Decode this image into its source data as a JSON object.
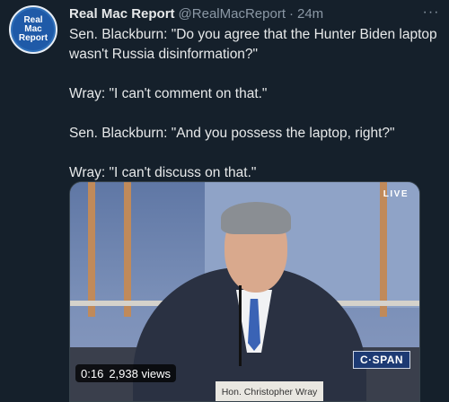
{
  "tweet": {
    "author_name": "Real Mac Report",
    "author_handle": "@RealMacReport",
    "separator": "·",
    "time": "24m",
    "more_label": "···",
    "avatar_lines": [
      "Real",
      "Mac",
      "Report"
    ],
    "text_lines": [
      "Sen. Blackburn: \"Do you agree that the Hunter Biden laptop wasn't Russia disinformation?\"",
      "Wray: \"I can't comment on that.\"",
      "Sen. Blackburn: \"And you possess the laptop, right?\"",
      "Wray: \"I can't discuss on that.\""
    ]
  },
  "media": {
    "live_label": "LIVE",
    "network_logo": "C·SPAN",
    "nameplate": "Hon. Christopher Wray",
    "duration": "0:16",
    "views": "2,938 views"
  },
  "colors": {
    "background": "#15202b",
    "text": "#e7e9ea",
    "muted": "#8b98a5",
    "avatar": "#1f5aa8"
  }
}
